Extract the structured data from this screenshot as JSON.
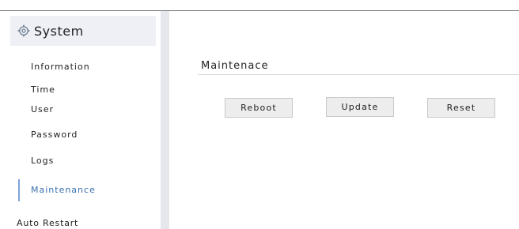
{
  "sidebar": {
    "title": "System",
    "icon": "gear-icon",
    "items": [
      {
        "label": "Information",
        "active": false
      },
      {
        "label": "Time",
        "active": false
      },
      {
        "label": "User",
        "active": false
      },
      {
        "label": "Password",
        "active": false
      },
      {
        "label": "Logs",
        "active": false
      },
      {
        "label": "Maintenance",
        "active": true
      }
    ],
    "extra_item": "Auto Restart"
  },
  "main": {
    "section_title": "Maintenace",
    "buttons": {
      "reboot": "Reboot",
      "update": "Update",
      "reset": "Reset"
    }
  },
  "colors": {
    "active_text": "#3a6fb0",
    "active_bar": "#7ea4d8",
    "header_bg": "#eef0f6",
    "separator": "#e6e7ec",
    "button_bg": "#ededed"
  }
}
